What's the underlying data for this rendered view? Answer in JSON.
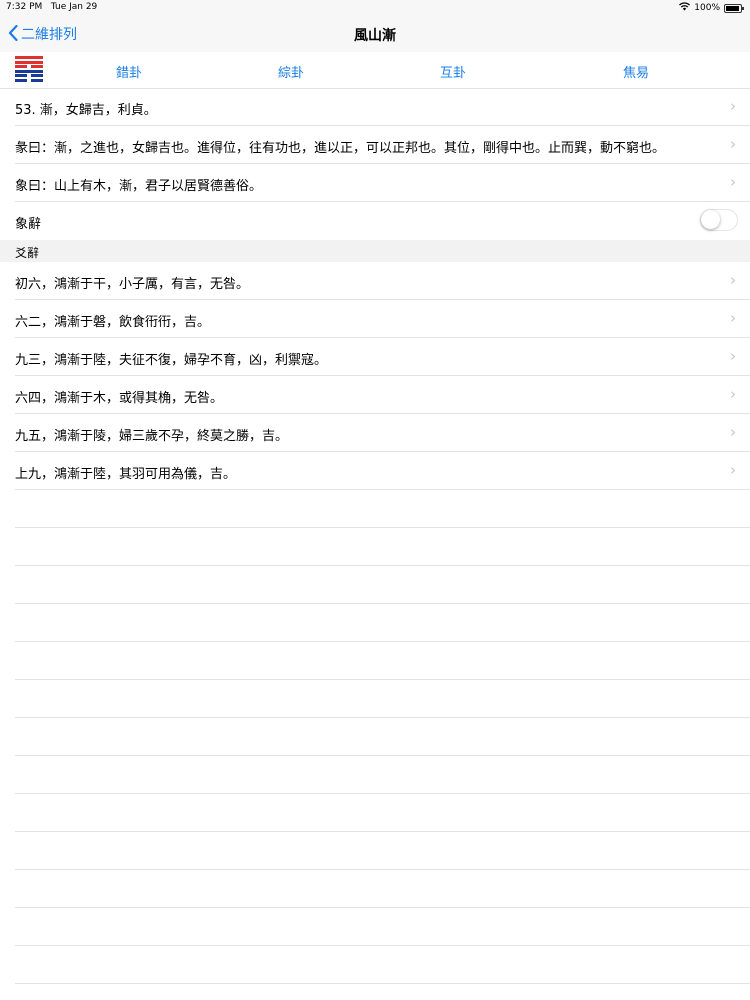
{
  "status": {
    "time": "7:32 PM",
    "date": "Tue Jan 29",
    "battery": "100%",
    "wifi_icon": "wifi-icon",
    "battery_icon": "battery-icon"
  },
  "nav": {
    "back_label": "二維排列",
    "title": "風山漸"
  },
  "hexagram": {
    "icon": "hexagram-icon",
    "lines_top_to_bottom": [
      "solid",
      "solid",
      "broken",
      "solid",
      "broken",
      "broken"
    ],
    "colors": {
      "top": "#e03030",
      "bottom": "#1a3a9a"
    },
    "tabs": [
      "錯卦",
      "綜卦",
      "互卦",
      "焦易"
    ]
  },
  "rows": [
    "53. 漸，女歸吉，利貞。",
    "彖曰：漸，之進也，女歸吉也。進得位，往有功也，進以正，可以正邦也。其位，剛得中也。止而巽，動不窮也。",
    "象曰：山上有木，漸，君子以居賢德善俗。"
  ],
  "toggle_row": {
    "label": "象辭",
    "on": false
  },
  "section": {
    "title": "爻辭"
  },
  "lines": [
    "初六，鴻漸于干，小子厲，有言，无咎。",
    "六二，鴻漸于磐，飲食衎衎，吉。",
    "九三，鴻漸于陸，夫征不復，婦孕不育，凶，利禦寇。",
    "六四，鴻漸于木，或得其桷，无咎。",
    "九五，鴻漸于陵，婦三歲不孕，終莫之勝，吉。",
    "上九，鴻漸于陸，其羽可用為儀，吉。"
  ],
  "accent_color": "#1a7ee6"
}
